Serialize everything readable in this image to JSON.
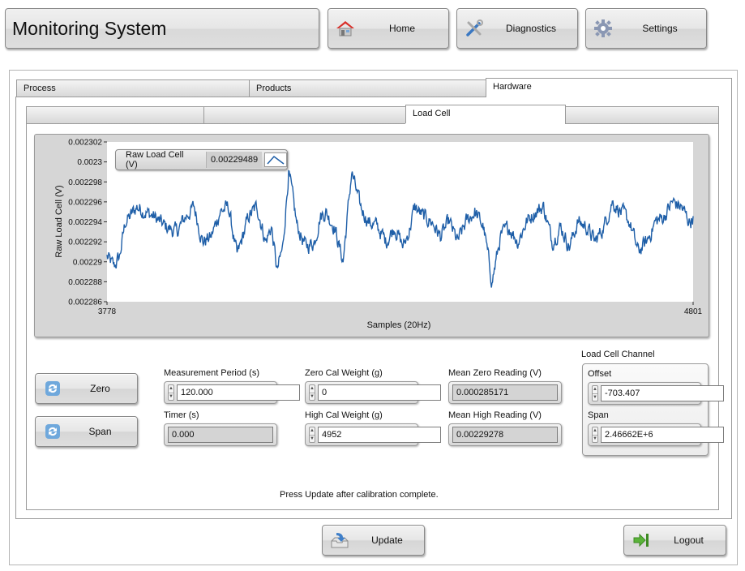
{
  "header": {
    "title": "Monitoring System",
    "nav": [
      {
        "label": "Home",
        "icon": "home-icon"
      },
      {
        "label": "Diagnostics",
        "icon": "tools-icon"
      },
      {
        "label": "Settings",
        "icon": "gear-icon"
      }
    ]
  },
  "tabs": [
    {
      "label": "Process",
      "active": false
    },
    {
      "label": "Products",
      "active": false
    },
    {
      "label": "Hardware",
      "active": true
    }
  ],
  "subtabs": [
    {
      "label": "",
      "active": false
    },
    {
      "label": "",
      "active": false
    },
    {
      "label": "Load Cell",
      "active": true
    },
    {
      "label": "",
      "active": false
    }
  ],
  "chart_data": {
    "type": "line",
    "title": "",
    "xlabel": "Samples (20Hz)",
    "ylabel": "Raw Load Cell (V)",
    "xlim": [
      3778,
      4801
    ],
    "ylim": [
      0.002286,
      0.002302
    ],
    "x_ticks": [
      "3778",
      "4801"
    ],
    "y_ticks": [
      "0.002302",
      "0.0023",
      "0.002298",
      "0.002296",
      "0.002294",
      "0.002292",
      "0.00229",
      "0.002288",
      "0.002286"
    ],
    "grid": false,
    "line_color": "#1f5fa8",
    "legend": {
      "name": "Raw Load Cell (V)",
      "current_value": "0.00229489",
      "position": "top-left"
    },
    "series": [
      {
        "name": "Raw Load Cell (V)",
        "keypoints_x": [
          3778,
          3790,
          3800,
          3810,
          3818,
          3830,
          3845,
          3860,
          3880,
          3900,
          3915,
          3930,
          3945,
          3960,
          3975,
          3990,
          4005,
          4015,
          4025,
          4040,
          4055,
          4065,
          4075,
          4085,
          4095,
          4110,
          4125,
          4140,
          4150,
          4160,
          4175,
          4190,
          4205,
          4220,
          4235,
          4250,
          4265,
          4280,
          4295,
          4305,
          4315,
          4330,
          4345,
          4360,
          4375,
          4390,
          4405,
          4420,
          4435,
          4450,
          4465,
          4480,
          4495,
          4510,
          4525,
          4540,
          4555,
          4570,
          4585,
          4600,
          4615,
          4630,
          4645,
          4660,
          4675,
          4690,
          4705,
          4720,
          4735,
          4750,
          4765,
          4780,
          4795,
          4801
        ],
        "keypoints_y": [
          0.0022905,
          0.0022895,
          0.0022905,
          0.002294,
          0.0022945,
          0.0022955,
          0.002295,
          0.0022945,
          0.0022935,
          0.002293,
          0.0022945,
          0.0022955,
          0.002292,
          0.0022925,
          0.002295,
          0.0022955,
          0.0022905,
          0.0022925,
          0.0022945,
          0.0022955,
          0.002292,
          0.0022935,
          0.002289,
          0.0022915,
          0.002299,
          0.0022935,
          0.0022915,
          0.002292,
          0.0022945,
          0.002295,
          0.0022935,
          0.00229,
          0.002299,
          0.0022955,
          0.002294,
          0.0022935,
          0.002292,
          0.0022935,
          0.0022915,
          0.002293,
          0.0022955,
          0.0022945,
          0.002294,
          0.0022925,
          0.002294,
          0.002292,
          0.002294,
          0.002295,
          0.0022935,
          0.002288,
          0.0022925,
          0.0022935,
          0.002292,
          0.002294,
          0.002295,
          0.0022955,
          0.002292,
          0.0022935,
          0.0022915,
          0.002294,
          0.0022935,
          0.002292,
          0.0022935,
          0.002296,
          0.002295,
          0.002294,
          0.002291,
          0.002292,
          0.002294,
          0.0022945,
          0.002296,
          0.0022955,
          0.002294,
          0.0022945
        ],
        "noise_amplitude": 8e-07,
        "sample_count": 1024
      }
    ]
  },
  "controls": {
    "zero_button": "Zero",
    "span_button": "Span",
    "measurement_period": {
      "label": "Measurement Period (s)",
      "value": "120.000"
    },
    "timer": {
      "label": "Timer (s)",
      "value": "0.000"
    },
    "zero_cal_weight": {
      "label": "Zero Cal Weight (g)",
      "value": "0"
    },
    "high_cal_weight": {
      "label": "High Cal Weight (g)",
      "value": "4952"
    },
    "mean_zero_reading": {
      "label": "Mean Zero Reading (V)",
      "value": "0.000285171"
    },
    "mean_high_reading": {
      "label": "Mean High Reading (V)",
      "value": "0.00229278"
    },
    "load_cell_channel": {
      "label": "Load Cell Channel",
      "offset": {
        "label": "Offset",
        "value": "-703.407"
      },
      "span": {
        "label": "Span",
        "value": "2.46662E+6"
      }
    }
  },
  "status_message": "Press Update after calibration complete.",
  "footer": {
    "update_button": "Update",
    "logout_button": "Logout"
  }
}
